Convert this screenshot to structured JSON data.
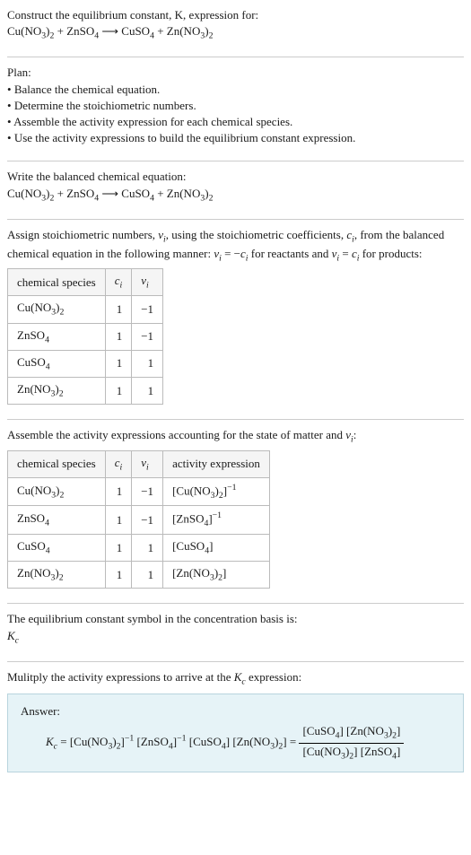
{
  "intro": {
    "line1": "Construct the equilibrium constant, K, expression for:",
    "eq_html": "Cu(NO<span class='sub'>3</span>)<span class='sub'>2</span> + ZnSO<span class='sub'>4</span>  ⟶  CuSO<span class='sub'>4</span> + Zn(NO<span class='sub'>3</span>)<span class='sub'>2</span>"
  },
  "plan": {
    "header": "Plan:",
    "items": [
      "Balance the chemical equation.",
      "Determine the stoichiometric numbers.",
      "Assemble the activity expression for each chemical species.",
      "Use the activity expressions to build the equilibrium constant expression."
    ]
  },
  "balanced": {
    "header": "Write the balanced chemical equation:",
    "eq_html": "Cu(NO<span class='sub'>3</span>)<span class='sub'>2</span> + ZnSO<span class='sub'>4</span>  ⟶  CuSO<span class='sub'>4</span> + Zn(NO<span class='sub'>3</span>)<span class='sub'>2</span>"
  },
  "assign": {
    "text_html": "Assign stoichiometric numbers, <span class='italic'>ν<span class='sub'>i</span></span>, using the stoichiometric coefficients, <span class='italic'>c<span class='sub'>i</span></span>, from the balanced chemical equation in the following manner: <span class='italic'>ν<span class='sub'>i</span></span> = −<span class='italic'>c<span class='sub'>i</span></span> for reactants and <span class='italic'>ν<span class='sub'>i</span></span> = <span class='italic'>c<span class='sub'>i</span></span> for products:",
    "headers": {
      "species": "chemical species",
      "ci_html": "<span class='italic'>c<span class='sub'>i</span></span>",
      "vi_html": "<span class='italic'>ν<span class='sub'>i</span></span>"
    },
    "rows": [
      {
        "species_html": "Cu(NO<span class='sub'>3</span>)<span class='sub'>2</span>",
        "ci": "1",
        "vi": "−1"
      },
      {
        "species_html": "ZnSO<span class='sub'>4</span>",
        "ci": "1",
        "vi": "−1"
      },
      {
        "species_html": "CuSO<span class='sub'>4</span>",
        "ci": "1",
        "vi": "1"
      },
      {
        "species_html": "Zn(NO<span class='sub'>3</span>)<span class='sub'>2</span>",
        "ci": "1",
        "vi": "1"
      }
    ]
  },
  "activity": {
    "header_html": "Assemble the activity expressions accounting for the state of matter and <span class='italic'>ν<span class='sub'>i</span></span>:",
    "headers": {
      "species": "chemical species",
      "ci_html": "<span class='italic'>c<span class='sub'>i</span></span>",
      "vi_html": "<span class='italic'>ν<span class='sub'>i</span></span>",
      "activity": "activity expression"
    },
    "rows": [
      {
        "species_html": "Cu(NO<span class='sub'>3</span>)<span class='sub'>2</span>",
        "ci": "1",
        "vi": "−1",
        "act_html": "[Cu(NO<span class='sub'>3</span>)<span class='sub'>2</span>]<span class='sup'>−1</span>"
      },
      {
        "species_html": "ZnSO<span class='sub'>4</span>",
        "ci": "1",
        "vi": "−1",
        "act_html": "[ZnSO<span class='sub'>4</span>]<span class='sup'>−1</span>"
      },
      {
        "species_html": "CuSO<span class='sub'>4</span>",
        "ci": "1",
        "vi": "1",
        "act_html": "[CuSO<span class='sub'>4</span>]"
      },
      {
        "species_html": "Zn(NO<span class='sub'>3</span>)<span class='sub'>2</span>",
        "ci": "1",
        "vi": "1",
        "act_html": "[Zn(NO<span class='sub'>3</span>)<span class='sub'>2</span>]"
      }
    ]
  },
  "symbol": {
    "line1": "The equilibrium constant symbol in the concentration basis is:",
    "line2_html": "<span class='italic'>K<span class='sub'>c</span></span>"
  },
  "multiply": {
    "header_html": "Mulitply the activity expressions to arrive at the <span class='italic'>K<span class='sub'>c</span></span> expression:"
  },
  "answer": {
    "label": "Answer:",
    "lhs_html": "<span class='italic'>K<span class='sub'>c</span></span> = [Cu(NO<span class='sub'>3</span>)<span class='sub'>2</span>]<span class='sup'>−1</span> [ZnSO<span class='sub'>4</span>]<span class='sup'>−1</span> [CuSO<span class='sub'>4</span>] [Zn(NO<span class='sub'>3</span>)<span class='sub'>2</span>] = ",
    "frac_num_html": "[CuSO<span class='sub'>4</span>] [Zn(NO<span class='sub'>3</span>)<span class='sub'>2</span>]",
    "frac_den_html": "[Cu(NO<span class='sub'>3</span>)<span class='sub'>2</span>] [ZnSO<span class='sub'>4</span>]"
  }
}
